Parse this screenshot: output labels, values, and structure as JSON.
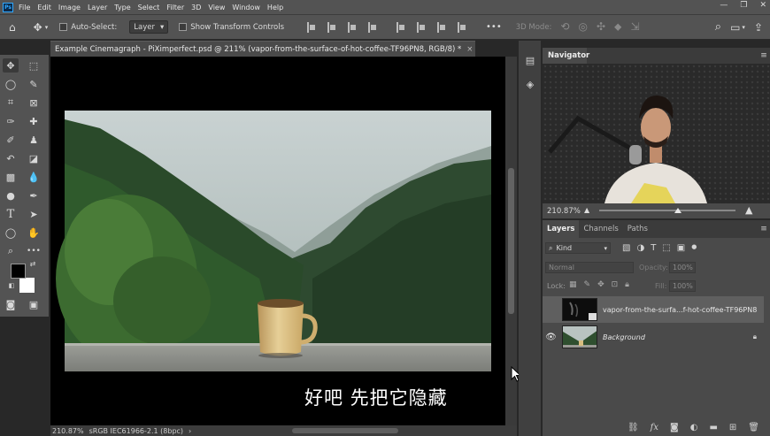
{
  "app": {
    "logo_text": "Ps",
    "menu": [
      "File",
      "Edit",
      "Image",
      "Layer",
      "Type",
      "Select",
      "Filter",
      "3D",
      "View",
      "Window",
      "Help"
    ],
    "window_controls": [
      "—",
      "❐",
      "✕"
    ]
  },
  "options_bar": {
    "auto_select_label": "Auto-Select:",
    "auto_select_value": "Layer",
    "show_transform_label": "Show Transform Controls",
    "more_label": "•••",
    "mode_3d_label": "3D Mode:"
  },
  "document": {
    "tab_title": "Example Cinemagraph - PiXimperfect.psd @ 211% (vapor-from-the-surface-of-hot-coffee-TF96PN8, RGB/8) *",
    "tab_close": "×",
    "subtitle_text": "好吧 先把它隐藏",
    "status_zoom": "210.87%",
    "status_profile": "sRGB IEC61966-2.1 (8bpc)",
    "status_arrow": "›"
  },
  "navigator": {
    "tab_label": "Navigator",
    "zoom_value": "210.87%"
  },
  "layers": {
    "tabs": [
      "Layers",
      "Channels",
      "Paths"
    ],
    "filter_kind": "Kind",
    "blend_mode": "Normal",
    "opacity_label": "Opacity:",
    "opacity_value": "100%",
    "lock_label": "Lock:",
    "fill_label": "Fill:",
    "fill_value": "100%",
    "rows": [
      {
        "name": "vapor-from-the-surfa...f-hot-coffee-TF96PN8",
        "visible": false,
        "selected": true
      },
      {
        "name": "Background",
        "visible": true,
        "selected": false
      }
    ],
    "bottom_icons": [
      "link-icon",
      "fx-icon",
      "mask-icon",
      "adjustment-icon",
      "folder-icon",
      "new-layer-icon",
      "trash-icon"
    ],
    "fx_label": "fx"
  },
  "colors": {
    "accent": "#31a8ff",
    "panel": "#4a4a4a",
    "panel_dark": "#3b3b3b",
    "selected_row": "#5f5f5f"
  }
}
